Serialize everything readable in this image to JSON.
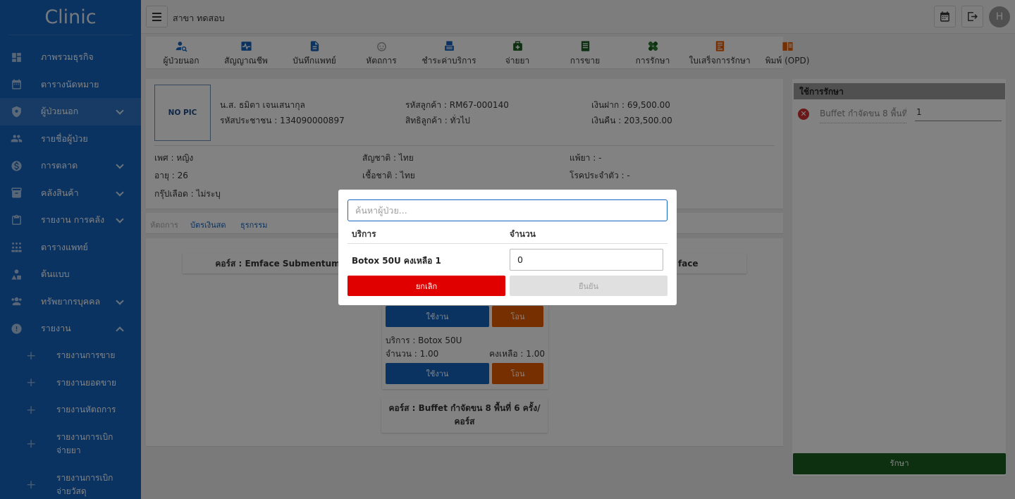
{
  "app": {
    "title": "Clinic"
  },
  "sidebar": {
    "items": [
      {
        "label": "ภาพรวมธุรกิจ",
        "icon": "dashboard-icon"
      },
      {
        "label": "ตารางนัดหมาย",
        "icon": "calendar-icon"
      },
      {
        "label": "ผู้ป่วยนอก",
        "icon": "shield-icon",
        "active": true,
        "expandable": true
      },
      {
        "label": "รายชื่อผู้ป่วย",
        "icon": "people-icon"
      },
      {
        "label": "การตลาด",
        "icon": "dollar-icon",
        "expandable": true
      },
      {
        "label": "คลังสินค้า",
        "icon": "archive-icon",
        "expandable": true
      },
      {
        "label": "รายงาน การคลัง",
        "icon": "clipboard-icon",
        "expandable": true
      },
      {
        "label": "ตารางแพทย์",
        "icon": "team-icon"
      },
      {
        "label": "ต้นแบบ",
        "icon": "shapes-icon"
      },
      {
        "label": "ทรัพยากรบุคคล",
        "icon": "group-icon",
        "expandable": true
      },
      {
        "label": "รายงาน",
        "icon": "alert-icon",
        "expanded": true
      }
    ],
    "sub_items": [
      "รายงานการขาย",
      "รายงานยอดขาย",
      "รายงานหัตถการ",
      "รายงานการเบิก\nจ่ายยา",
      "รายงานการเบิก\nจ่ายวัสดุ"
    ]
  },
  "topbar": {
    "branch": "สาขา ทดสอบ",
    "avatar_letter": "H"
  },
  "toolbar": {
    "items": [
      {
        "label": "ผู้ป่วยนอก",
        "color": "#1565c0",
        "icon": "patient-search-icon"
      },
      {
        "label": "สัญญาณชีพ",
        "color": "#1565c0",
        "icon": "vitals-icon"
      },
      {
        "label": "บันทึกแพทย์",
        "color": "#1565c0",
        "icon": "doctor-note-icon"
      },
      {
        "label": "หัตถการ",
        "color": "#9e9e9e",
        "icon": "procedure-icon"
      },
      {
        "label": "ชำระค่าบริการ",
        "color": "#1565c0",
        "icon": "payment-icon"
      },
      {
        "label": "จ่ายยา",
        "color": "#1b5e20",
        "icon": "medicine-icon"
      },
      {
        "label": "การขาย",
        "color": "#1b5e20",
        "icon": "sales-icon"
      },
      {
        "label": "การรักษา",
        "color": "#1b5e20",
        "icon": "treatment-icon"
      },
      {
        "label": "ใบเสร็จการรักษา",
        "color": "#e65c00",
        "icon": "receipt-icon"
      },
      {
        "label": "พิมพ์ (OPD)",
        "color": "#e65c00",
        "icon": "print-icon"
      }
    ]
  },
  "patient": {
    "photo": "NO PIC",
    "name": "น.ส. ธมิตา เจนเสนากุล",
    "citizen_id": "รหัสประชาชน : 134090000897",
    "customer_code": "รหัสลูกค้า : RM67-000140",
    "customer_right": "สิทธิลูกค้า : ทั่วไป",
    "deposit": "เงินฝาก : 69,500.00",
    "refund": "เงินคืน : 203,500.00",
    "gender": "เพศ : หญิง",
    "age": "อายุ : 26",
    "blood": "กรุ๊ปเลือด : ไม่ระบุ",
    "nationality": "สัญชาติ : ไทย",
    "race": "เชื้อชาติ : ไทย",
    "allergy": "แพ้ยา : -",
    "disease": "โรคประจำตัว : -"
  },
  "tabs": [
    "หัตถการ",
    "บัตรเงินสด",
    "ธุรกรรม"
  ],
  "courses": {
    "left_title": "คอร์ส : Emface Submentum",
    "right_title_fragment": "face",
    "bottom_title": "คอร์ส : Buffet กำจัดขน 8 พื้นที่ 6 ครั้ง/\nคอร์ส",
    "use_label": "ใช้งาน",
    "transfer_label": "โอน",
    "service": "บริการ : Botox 50U",
    "amount": "จำนวน : 1.00",
    "remaining": "คงเหลือ : 1.00"
  },
  "treatment": {
    "title": "ใช้การรักษา",
    "row_name": "Buffet กำจัดขน 8 พื้นที่",
    "row_qty": "1",
    "button": "รักษา"
  },
  "modal": {
    "search_placeholder": "ค้นหาผู้ป่วย...",
    "col_service": "บริการ",
    "col_qty": "จำนวน",
    "item_name": "Botox 50U คงเหลือ 1",
    "qty_value": "0",
    "cancel": "ยกเลิก",
    "confirm": "ยืนยัน"
  }
}
